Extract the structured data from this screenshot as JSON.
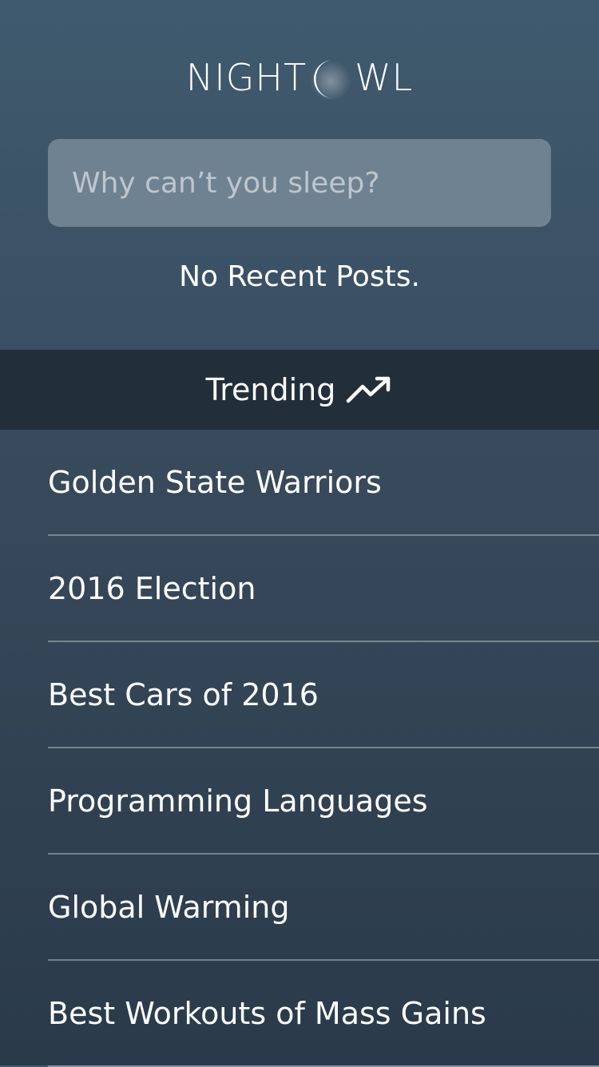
{
  "app": {
    "logo_text_left": "NIGHT",
    "logo_text_right": "WL",
    "logo_moon_icon": "crescent-moon-icon"
  },
  "search": {
    "placeholder": "Why can’t you sleep?"
  },
  "recent_posts": {
    "status": "No Recent Posts."
  },
  "trending": {
    "label": "Trending",
    "icon": "trending-up-icon"
  },
  "topics": [
    {
      "label": "Golden State Warriors"
    },
    {
      "label": "2016 Election"
    },
    {
      "label": "Best Cars of 2016"
    },
    {
      "label": "Programming Languages"
    },
    {
      "label": "Global Warming"
    },
    {
      "label": "Best Workouts of Mass Gains"
    }
  ],
  "colors": {
    "background_top": "#3f5a6e",
    "background_bottom": "#2a3a4a",
    "search_field": "#6f8291",
    "trending_bar": "#222e38",
    "text": "#ffffff"
  }
}
